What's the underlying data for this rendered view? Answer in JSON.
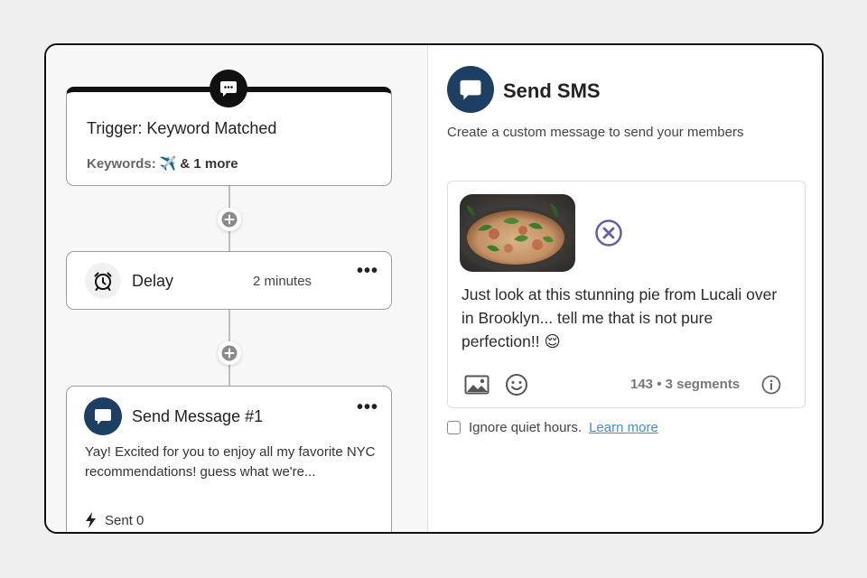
{
  "flow": {
    "trigger": {
      "title": "Trigger: Keyword Matched",
      "keywords_label": "Keywords:",
      "keyword_emoji": "✈️",
      "more_label": "& 1 more"
    },
    "delay": {
      "title": "Delay",
      "value": "2 minutes"
    },
    "message": {
      "title": "Send Message #1",
      "preview": "Yay! Excited for you to enjoy all my favorite NYC recommendations! guess what we're...",
      "sent_label": "Sent 0"
    },
    "menu_label": "•••"
  },
  "panel": {
    "title": "Send SMS",
    "subtitle": "Create a custom message to send your members",
    "message_text": "Just look at this stunning pie from Lucali over in Brooklyn... tell me that is not pure perfection!! 😌",
    "segments_info": "143 • 3 segments",
    "quiet_hours_label": "Ignore quiet hours.",
    "learn_more": "Learn more"
  },
  "colors": {
    "brand_navy": "#1d3f63",
    "remove_purple": "#6a5ba8",
    "link_blue": "#3b8ee8"
  },
  "icons": {
    "chat": "chat-bubble-icon",
    "alarm": "alarm-clock-icon",
    "plus": "plus-icon",
    "bolt": "lightning-bolt-icon",
    "remove": "close-circle-icon",
    "image": "image-icon",
    "emoji": "emoji-smile-icon",
    "info": "info-icon"
  }
}
